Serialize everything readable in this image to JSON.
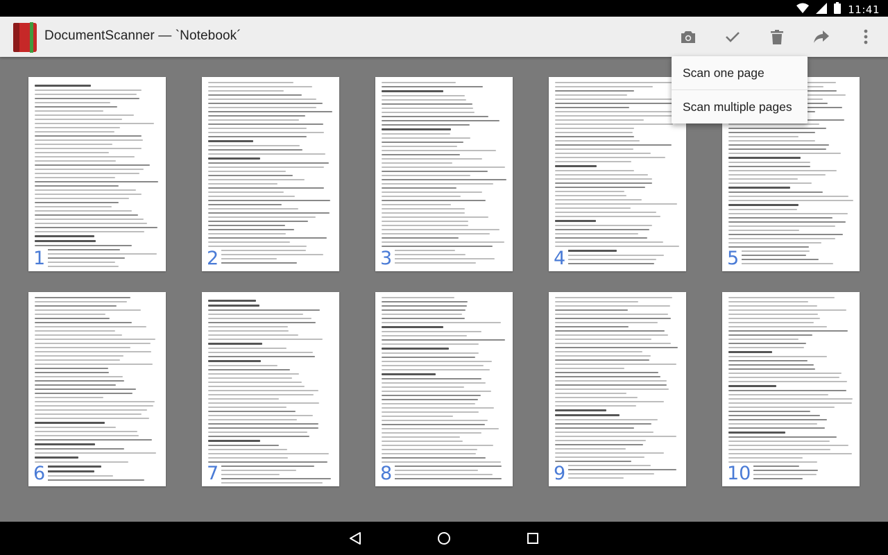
{
  "status_bar": {
    "time": "11:41"
  },
  "app_bar": {
    "title": "DocumentScanner — `Notebook´",
    "actions": [
      "camera-icon",
      "check-icon",
      "delete-icon",
      "share-icon",
      "more-vert-icon"
    ]
  },
  "menu": {
    "items": [
      "Scan one page",
      "Scan multiple pages"
    ]
  },
  "pages": [
    "1",
    "2",
    "3",
    "4",
    "5",
    "6",
    "7",
    "8",
    "9",
    "10"
  ],
  "navigation": [
    "back-icon",
    "home-icon",
    "recents-icon"
  ],
  "colors": {
    "page_number": "#4a7bd6",
    "app_bar": "#eeeeee",
    "background": "#7a7a7a",
    "app_icon": "#c62828"
  }
}
